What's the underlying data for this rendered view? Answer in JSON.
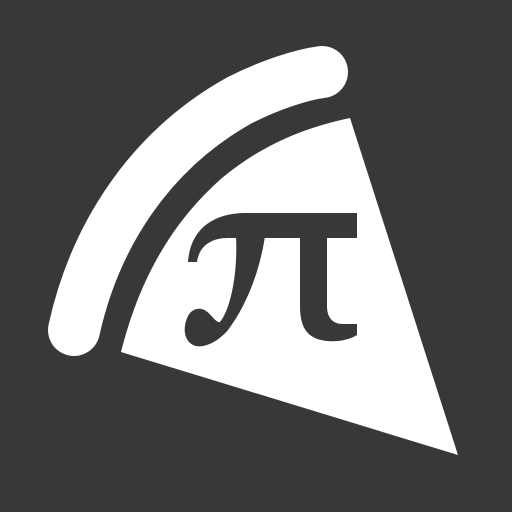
{
  "icon": {
    "name": "pizza-slice-pi-icon",
    "symbol": "π"
  },
  "colors": {
    "background": "#383838",
    "foreground": "#ffffff"
  }
}
